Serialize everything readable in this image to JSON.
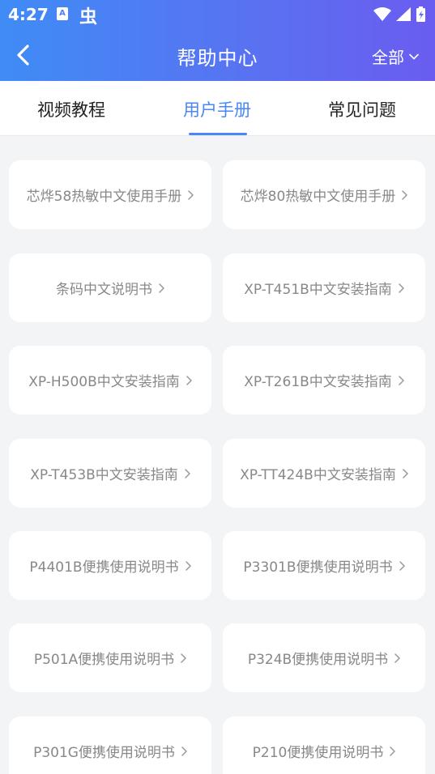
{
  "status": {
    "time": "4:27",
    "a_icon": "A",
    "bug_icon": "虫"
  },
  "nav": {
    "title": "帮助中心",
    "filter_label": "全部"
  },
  "tabs": [
    {
      "label": "视频教程",
      "active": false
    },
    {
      "label": "用户手册",
      "active": true
    },
    {
      "label": "常见问题",
      "active": false
    }
  ],
  "manuals": [
    {
      "label": "芯烨58热敏中文使用手册"
    },
    {
      "label": "芯烨80热敏中文使用手册"
    },
    {
      "label": "条码中文说明书"
    },
    {
      "label": "XP-T451B中文安装指南"
    },
    {
      "label": "XP-H500B中文安装指南"
    },
    {
      "label": "XP-T261B中文安装指南"
    },
    {
      "label": "XP-T453B中文安装指南"
    },
    {
      "label": "XP-TT424B中文安装指南"
    },
    {
      "label": "P4401B便携使用说明书"
    },
    {
      "label": "P3301B便携使用说明书"
    },
    {
      "label": "P501A便携使用说明书"
    },
    {
      "label": "P324B便携使用说明书"
    },
    {
      "label": "P301G便携使用说明书"
    },
    {
      "label": "P210便携使用说明书"
    }
  ],
  "colors": {
    "accent": "#4a86f7",
    "header_start": "#3f8cf6",
    "header_end": "#6a5cf0",
    "card_text": "#888888"
  }
}
